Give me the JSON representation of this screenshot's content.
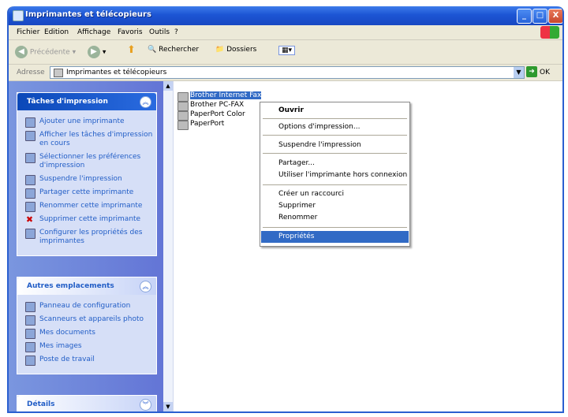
{
  "window": {
    "title": "Imprimantes et télécopieurs",
    "controls": {
      "minimize": "_",
      "maximize": "□",
      "close": "X"
    }
  },
  "menu": [
    "Fichier",
    "Edition",
    "Affichage",
    "Favoris",
    "Outils",
    "?"
  ],
  "toolbar": {
    "back": "Précédente",
    "search": "Rechercher",
    "folders": "Dossiers"
  },
  "address": {
    "label": "Adresse",
    "value": "Imprimantes et télécopieurs",
    "go": "OK"
  },
  "tasks_panel": {
    "title": "Tâches d'impression",
    "items": [
      "Ajouter une imprimante",
      "Afficher les tâches d'impression en cours",
      "Sélectionner les préférences d'impression",
      "Suspendre l'impression",
      "Partager cette imprimante",
      "Renommer cette imprimante",
      "Supprimer cette imprimante",
      "Configurer les propriétés des imprimantes"
    ]
  },
  "other_panel": {
    "title": "Autres emplacements",
    "items": [
      "Panneau de configuration",
      "Scanneurs et appareils photo",
      "Mes documents",
      "Mes images",
      "Poste de travail"
    ]
  },
  "details_panel": {
    "title": "Détails"
  },
  "printers": [
    "Brother Internet Fax",
    "Brother PC-FAX",
    "PaperPort Color",
    "PaperPort"
  ],
  "context_menu": [
    "Ouvrir",
    "Options d'impression...",
    "Suspendre l'impression",
    "Partager...",
    "Utiliser l'imprimante hors connexion",
    "Créer un raccourci",
    "Supprimer",
    "Renommer",
    "Propriétés"
  ]
}
